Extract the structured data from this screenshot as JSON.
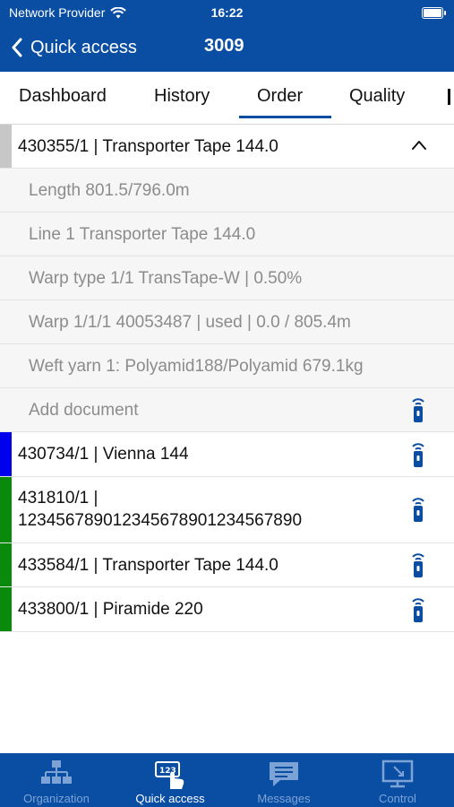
{
  "status_bar": {
    "carrier": "Network Provider",
    "time": "16:22"
  },
  "header": {
    "back_label": "Quick access",
    "title": "3009"
  },
  "tabs": [
    {
      "label": "Dashboard"
    },
    {
      "label": "History"
    },
    {
      "label": "Order",
      "active": true
    },
    {
      "label": "Quality"
    }
  ],
  "orders": {
    "expanded": {
      "title": "430355/1 | Transporter Tape 144.0",
      "strip_color": "#c7c7c7",
      "details": [
        "Length 801.5/796.0m",
        "Line 1 Transporter Tape 144.0",
        "Warp type 1/1 TransTape-W | 0.50%",
        "Warp 1/1/1 40053487 | used | 0.0 / 805.4m",
        "Weft yarn 1: Polyamid188/Polyamid 679.1kg"
      ],
      "add_document_label": "Add document"
    },
    "list": [
      {
        "line1": "430734/1 | Vienna 144",
        "line2": "",
        "strip_color": "#0000ee"
      },
      {
        "line1": "431810/1 |",
        "line2": "123456789012345678901234567890",
        "strip_color": "#0a8a0a"
      },
      {
        "line1": "433584/1 | Transporter Tape 144.0",
        "line2": "",
        "strip_color": "#0a8a0a"
      },
      {
        "line1": "433800/1 | Piramide 220",
        "line2": "",
        "strip_color": "#0a8a0a"
      }
    ]
  },
  "tabbar": {
    "items": [
      {
        "label": "Organization",
        "icon": "organization-icon",
        "active": false
      },
      {
        "label": "Quick access",
        "icon": "quick-access-icon",
        "active": true
      },
      {
        "label": "Messages",
        "icon": "messages-icon",
        "active": false
      },
      {
        "label": "Control",
        "icon": "control-icon",
        "active": false
      }
    ]
  },
  "colors": {
    "brand": "#0a4ea3",
    "inactive_tab": "#7da3d6",
    "sub_row_bg": "#f6f6f6"
  }
}
